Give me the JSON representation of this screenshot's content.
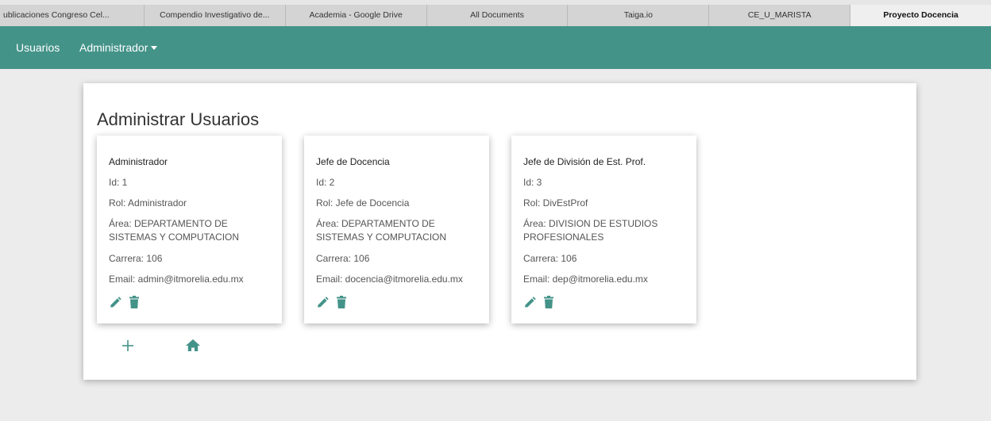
{
  "browser": {
    "tabs": [
      {
        "label": "ublicaciones Congreso Cel..."
      },
      {
        "label": "Compendio Investigativo de..."
      },
      {
        "label": "Academia - Google Drive"
      },
      {
        "label": "All Documents"
      },
      {
        "label": "Taiga.io"
      },
      {
        "label": "CE_U_MARISTA"
      },
      {
        "label": "Proyecto Docencia",
        "active": true
      }
    ]
  },
  "navbar": {
    "items": [
      {
        "label": "Usuarios"
      },
      {
        "label": "Administrador",
        "dropdown": true
      }
    ],
    "color": "#449389"
  },
  "main": {
    "title": "Administrar Usuarios",
    "users": [
      {
        "name": "Administrador",
        "id": "Id: 1",
        "rol": "Rol: Administrador",
        "area": "Área: DEPARTAMENTO DE SISTEMAS Y COMPUTACION",
        "carrera": "Carrera: 106",
        "email": "Email: admin@itmorelia.edu.mx"
      },
      {
        "name": "Jefe de Docencia",
        "id": "Id: 2",
        "rol": "Rol: Jefe de Docencia",
        "area": "Área: DEPARTAMENTO DE SISTEMAS Y COMPUTACION",
        "carrera": "Carrera: 106",
        "email": "Email: docencia@itmorelia.edu.mx"
      },
      {
        "name": "Jefe de División de Est. Prof.",
        "id": "Id: 3",
        "rol": "Rol: DivEstProf",
        "area": "Área: DIVISION DE ESTUDIOS PROFESIONALES",
        "carrera": "Carrera: 106",
        "email": "Email: dep@itmorelia.edu.mx"
      }
    ],
    "icons": {
      "edit": "pencil-icon",
      "delete": "trash-icon",
      "add": "plus-icon",
      "home": "home-icon"
    },
    "icon_color": "#449389"
  }
}
